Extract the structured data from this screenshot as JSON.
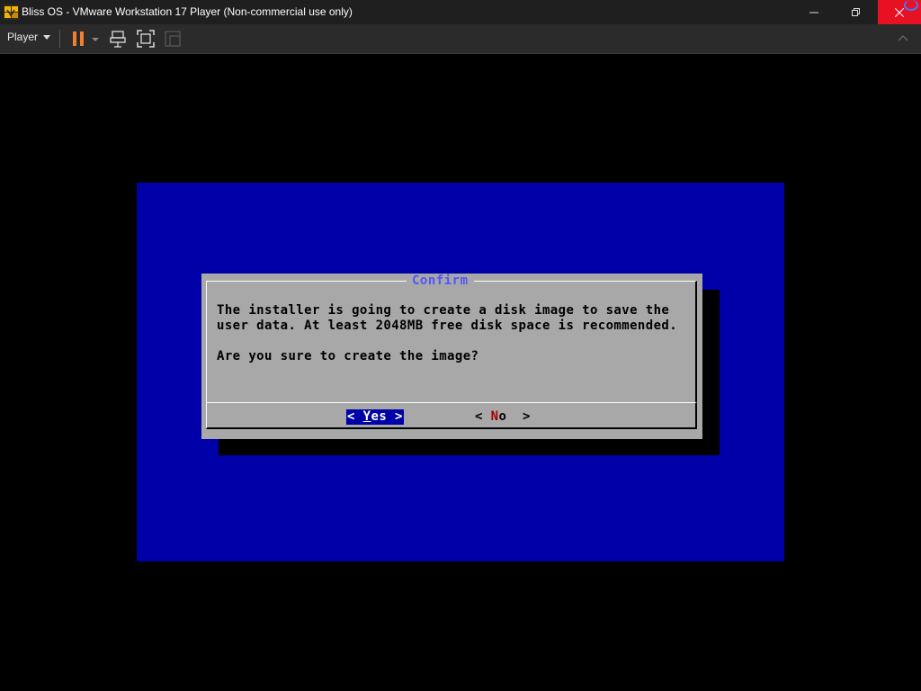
{
  "window": {
    "title": "Bliss OS - VMware Workstation 17 Player (Non-commercial use only)",
    "icons": {
      "app": "vmware-player-icon",
      "minimize": "minimize-icon",
      "maximize": "maximize-icon",
      "close": "close-icon"
    }
  },
  "toolbar": {
    "player_label": "Player",
    "icons": [
      "pause-icon",
      "send-ctrl-alt-del-icon",
      "fullscreen-icon",
      "unity-icon"
    ]
  },
  "dialog": {
    "title": "Confirm",
    "line1": "The installer is going to create a disk image to save the",
    "line2": "user data. At least 2048MB free disk space is recommended.",
    "line3": "Are you sure to create the image?",
    "yes_prefix": "< ",
    "yes_hotkey": "Y",
    "yes_rest": "es >",
    "no_prefix": "< ",
    "no_hotkey": "N",
    "no_rest": "o  >"
  },
  "colors": {
    "vm_background": "#0000a8",
    "dialog_background": "#a8a8a8",
    "title_color": "#5454fc",
    "close_button": "#e81123",
    "pause_accent": "#f08030"
  }
}
